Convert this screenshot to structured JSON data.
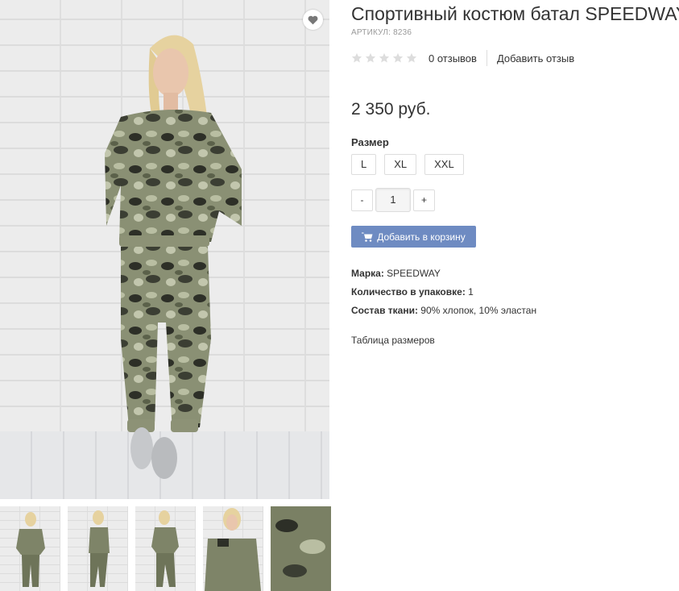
{
  "product": {
    "title": "Спортивный костюм батал SPEEDWAY",
    "sku": "АРТИКУЛ: 8236",
    "price": "2 350 руб."
  },
  "rating": {
    "stars": 0,
    "reviews_count": "0 отзывов",
    "add_review": "Добавить отзыв"
  },
  "sizes": {
    "label": "Размер",
    "options": [
      "L",
      "XL",
      "XXL"
    ]
  },
  "quantity": {
    "minus": "-",
    "value": "1",
    "plus": "+"
  },
  "cart": {
    "label": "Добавить в корзину",
    "icon": "cart-icon",
    "color": "#6e8bc2"
  },
  "properties": [
    {
      "label": "Марка:",
      "value": "SPEEDWAY"
    },
    {
      "label": "Количество в упаковке:",
      "value": "1"
    },
    {
      "label": "Состав ткани:",
      "value": "90% хлопок, 10% эластан"
    }
  ],
  "size_table_link": "Таблица размеров",
  "favorite_icon": "heart-icon",
  "thumbnails_count": 5
}
